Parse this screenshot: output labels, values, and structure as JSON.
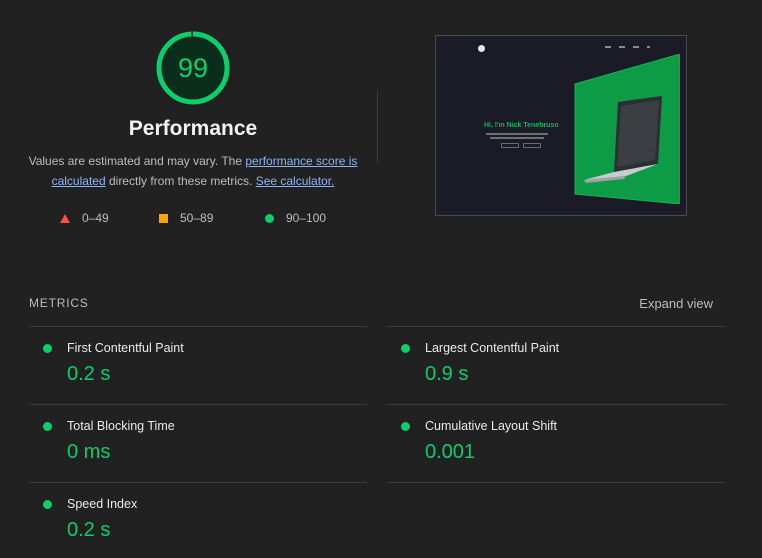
{
  "gauge": {
    "score": "99",
    "fraction": 0.99,
    "color": "#0cce6b"
  },
  "title": "Performance",
  "description": {
    "text1": "Values are estimated and may vary. The ",
    "link1": "performance score is calculated",
    "text2": " directly from these metrics. ",
    "link2": "See calculator."
  },
  "legend": [
    {
      "range": "0–49",
      "shape": "triangle-icon",
      "color": "#ff4e42"
    },
    {
      "range": "50–89",
      "shape": "square-icon",
      "color": "#ffa400"
    },
    {
      "range": "90–100",
      "shape": "circle-icon",
      "color": "#0cce6b"
    }
  ],
  "thumbnail": {
    "hero_title": "Hi, I'm Nick Tenebruso"
  },
  "metrics": {
    "label": "METRICS",
    "expand_label": "Expand view",
    "items": [
      {
        "name": "First Contentful Paint",
        "value": "0.2 s",
        "status": "good"
      },
      {
        "name": "Largest Contentful Paint",
        "value": "0.9 s",
        "status": "good"
      },
      {
        "name": "Total Blocking Time",
        "value": "0 ms",
        "status": "good"
      },
      {
        "name": "Cumulative Layout Shift",
        "value": "0.001",
        "status": "good"
      },
      {
        "name": "Speed Index",
        "value": "0.2 s",
        "status": "good"
      }
    ]
  }
}
